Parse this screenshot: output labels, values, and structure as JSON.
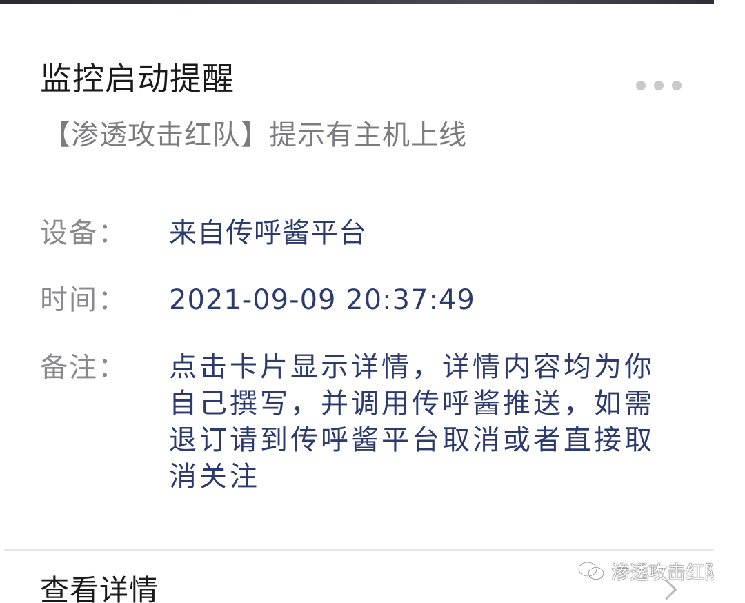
{
  "card": {
    "title": "监控启动提醒",
    "subtitle": "【渗透攻击红队】提示有主机上线",
    "fields": [
      {
        "label": "设备：",
        "value": "来自传呼酱平台"
      },
      {
        "label": "时间：",
        "value": "2021-09-09 20:37:49"
      },
      {
        "label": "备注：",
        "value": "点击卡片显示详情，详情内容均为你自己撰写，并调用传呼酱推送，如需退订请到传呼酱平台取消或者直接取消关注"
      }
    ],
    "footer_label": "查看详情",
    "more_icon": "more-dots-icon",
    "chevron_icon": "chevron-right-icon"
  },
  "watermark": {
    "text": "渗透攻击红队",
    "icon": "wechat-icon"
  },
  "colors": {
    "title": "#1a1a1a",
    "label": "#8a8a8e",
    "value": "#2c3a6e",
    "subtitle": "#7c7c80",
    "divider": "#e6e6e8"
  }
}
